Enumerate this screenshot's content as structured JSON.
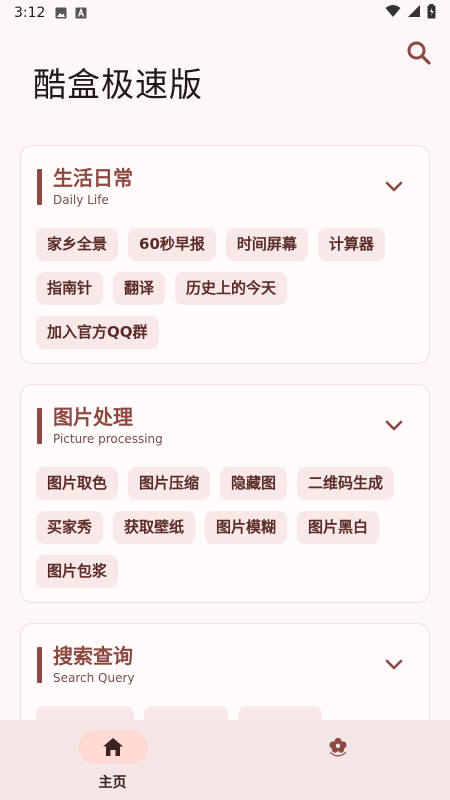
{
  "status_bar": {
    "time": "3:12"
  },
  "app": {
    "title": "酷盒极速版"
  },
  "icons": {
    "search": "search-icon",
    "chevron": "chevron-down-icon",
    "home": "home-icon",
    "flower": "flower-icon"
  },
  "colors": {
    "accent": "#8c4a41",
    "chip_bg": "#f9e8e8",
    "nav_active": "#ffd9d4",
    "background": "#fef7f9"
  },
  "sections": [
    {
      "title": "生活日常",
      "subtitle": "Daily Life",
      "chips": [
        "家乡全景",
        "60秒早报",
        "时间屏幕",
        "计算器",
        "指南针",
        "翻译",
        "历史上的今天",
        "加入官方QQ群"
      ]
    },
    {
      "title": "图片处理",
      "subtitle": "Picture processing",
      "chips": [
        "图片取色",
        "图片压缩",
        "隐藏图",
        "二维码生成",
        "买家秀",
        "获取壁纸",
        "图片模糊",
        "图片黑白",
        "图片包浆"
      ]
    },
    {
      "title": "搜索查询",
      "subtitle": "Search Query",
      "chips": []
    }
  ],
  "bottom_nav": [
    {
      "label": "主页",
      "active": true
    },
    {
      "label": "",
      "active": false
    }
  ]
}
